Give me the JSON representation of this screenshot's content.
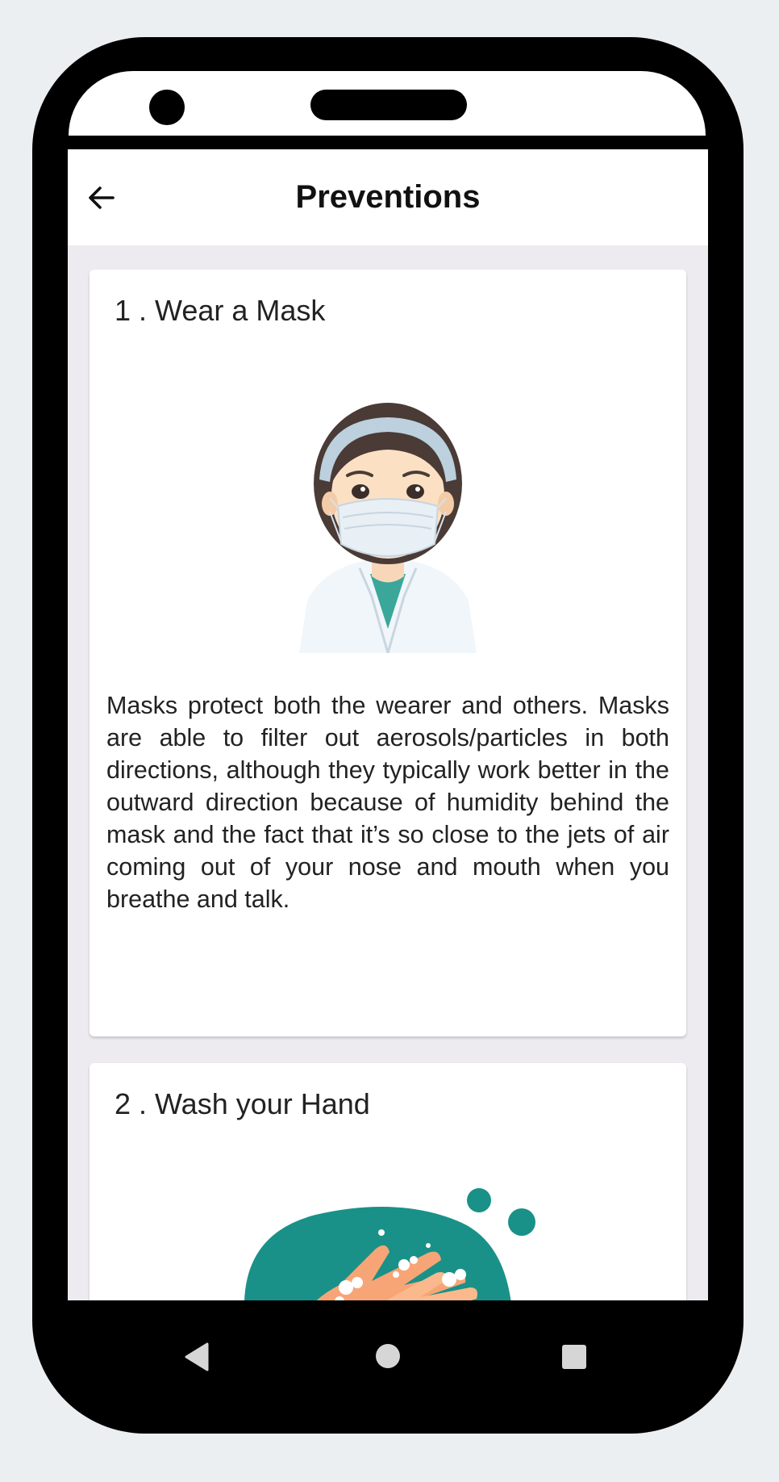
{
  "app": {
    "title": "Preventions"
  },
  "icons": {
    "back": "arrow-left-icon",
    "nav_back": "triangle-back-icon",
    "nav_home": "circle-home-icon",
    "nav_recents": "square-recents-icon"
  },
  "cards": [
    {
      "title": "1 . Wear a Mask",
      "body": "Masks protect both the wearer and others. Masks are able to filter out aerosols/particles in both directions, although they typically work better in the outward direction because of humidity behind the mask and the fact that it’s so close to the jets of air coming out of your nose and mouth when you breathe and talk.",
      "illustration": "woman-wearing-mask-illustration"
    },
    {
      "title": "2 . Wash your Hand",
      "illustration": "hand-washing-illustration"
    }
  ],
  "colors": {
    "accent_teal": "#1a9188",
    "screen_background": "#edebf0"
  }
}
